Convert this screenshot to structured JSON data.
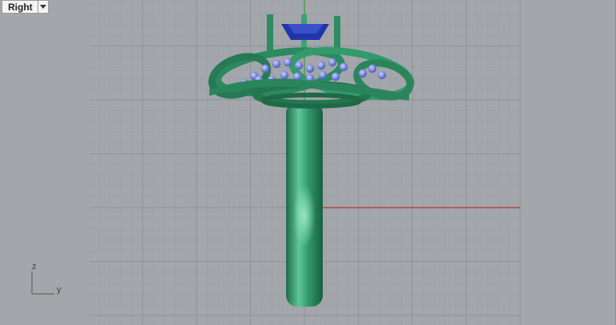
{
  "viewport": {
    "view_name": "Right",
    "view_menu_icon": "chevron-down-icon",
    "background_color": "#a3a6aa",
    "grid_color": "#9a9da1",
    "grid_major_color": "#8f9296",
    "x_axis_color": "#b03030",
    "y_axis_color": "#3a9a3a"
  },
  "axis_widget": {
    "vertical_label": "z",
    "horizontal_label": "y"
  },
  "model": {
    "metal_color": "#2e8c62",
    "gem_color": "#1f35a8",
    "small_stone_color": "#7f8fd8"
  }
}
